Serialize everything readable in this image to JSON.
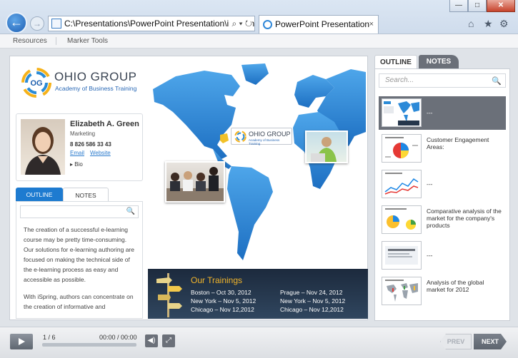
{
  "browser": {
    "window_buttons": {
      "minimize": "—",
      "maximize": "□",
      "close": "✕"
    },
    "back_icon": "arrow-left-icon",
    "address": "C:\\Presentations\\PowerPoint Presentation\\index.h",
    "address_tools": "⌕ ▾ ↻",
    "tab_title": "PowerPoint Presentation",
    "tab_close": "×",
    "toolbar_icons": {
      "home": "⌂",
      "favorites": "★",
      "settings": "⚙"
    }
  },
  "menubar": {
    "items": [
      "Resources",
      "Marker Tools"
    ]
  },
  "slide": {
    "logo": {
      "mark": "OG",
      "title": "OHIO GROUP",
      "subtitle": "Academy of Business Training"
    },
    "presenter": {
      "name": "Elizabeth A. Green",
      "role": "Marketing",
      "phone": "8 826 586 33 43",
      "email_label": "Email",
      "website_label": "Website",
      "bio_label": "Bio"
    },
    "left_tabs": [
      "OUTLINE",
      "NOTES"
    ],
    "notes_paragraphs": [
      "The creation of a successful e-learning course may be pretty time-consuming. Our solutions for e-learning authoring are focused on making the technical side of the e-learning process as easy and accessible as possible.",
      "With iSpring, authors can concentrate on the creation of informative and"
    ],
    "map_logo": {
      "title": "OHIO GROUP",
      "subtitle": "Academy of Business Training"
    },
    "trainings": {
      "title": "Our Trainings",
      "items": [
        "Boston – Oct 30, 2012",
        "Prague – Nov 24, 2012",
        "New York – Nov 5, 2012",
        "New York – Nov 5, 2012",
        "Chicago – Nov 12,2012",
        "Chicago – Nov 12,2012"
      ]
    }
  },
  "sidebar": {
    "tabs": [
      "OUTLINE",
      "NOTES"
    ],
    "search_placeholder": "Search...",
    "items": [
      {
        "label": "---",
        "selected": true
      },
      {
        "label": "Customer Engagement Areas:",
        "selected": false
      },
      {
        "label": "---",
        "selected": false
      },
      {
        "label": "Comparative analysis of the market for the company's products",
        "selected": false
      },
      {
        "label": "---",
        "selected": false
      },
      {
        "label": "Analysis of the global market for 2012",
        "selected": false
      }
    ]
  },
  "player": {
    "slide_counter": "1 / 6",
    "time": "00:00 / 00:00",
    "progress": 0,
    "prev_label": "PREV",
    "next_label": "NEXT",
    "volume_icon": "speaker-icon",
    "fullscreen_icon": "expand-icon"
  },
  "colors": {
    "accent": "#1e7bd0",
    "map": "#2c8ad8",
    "panel_dark": "#6b7079",
    "training_title": "#f2b52b"
  }
}
